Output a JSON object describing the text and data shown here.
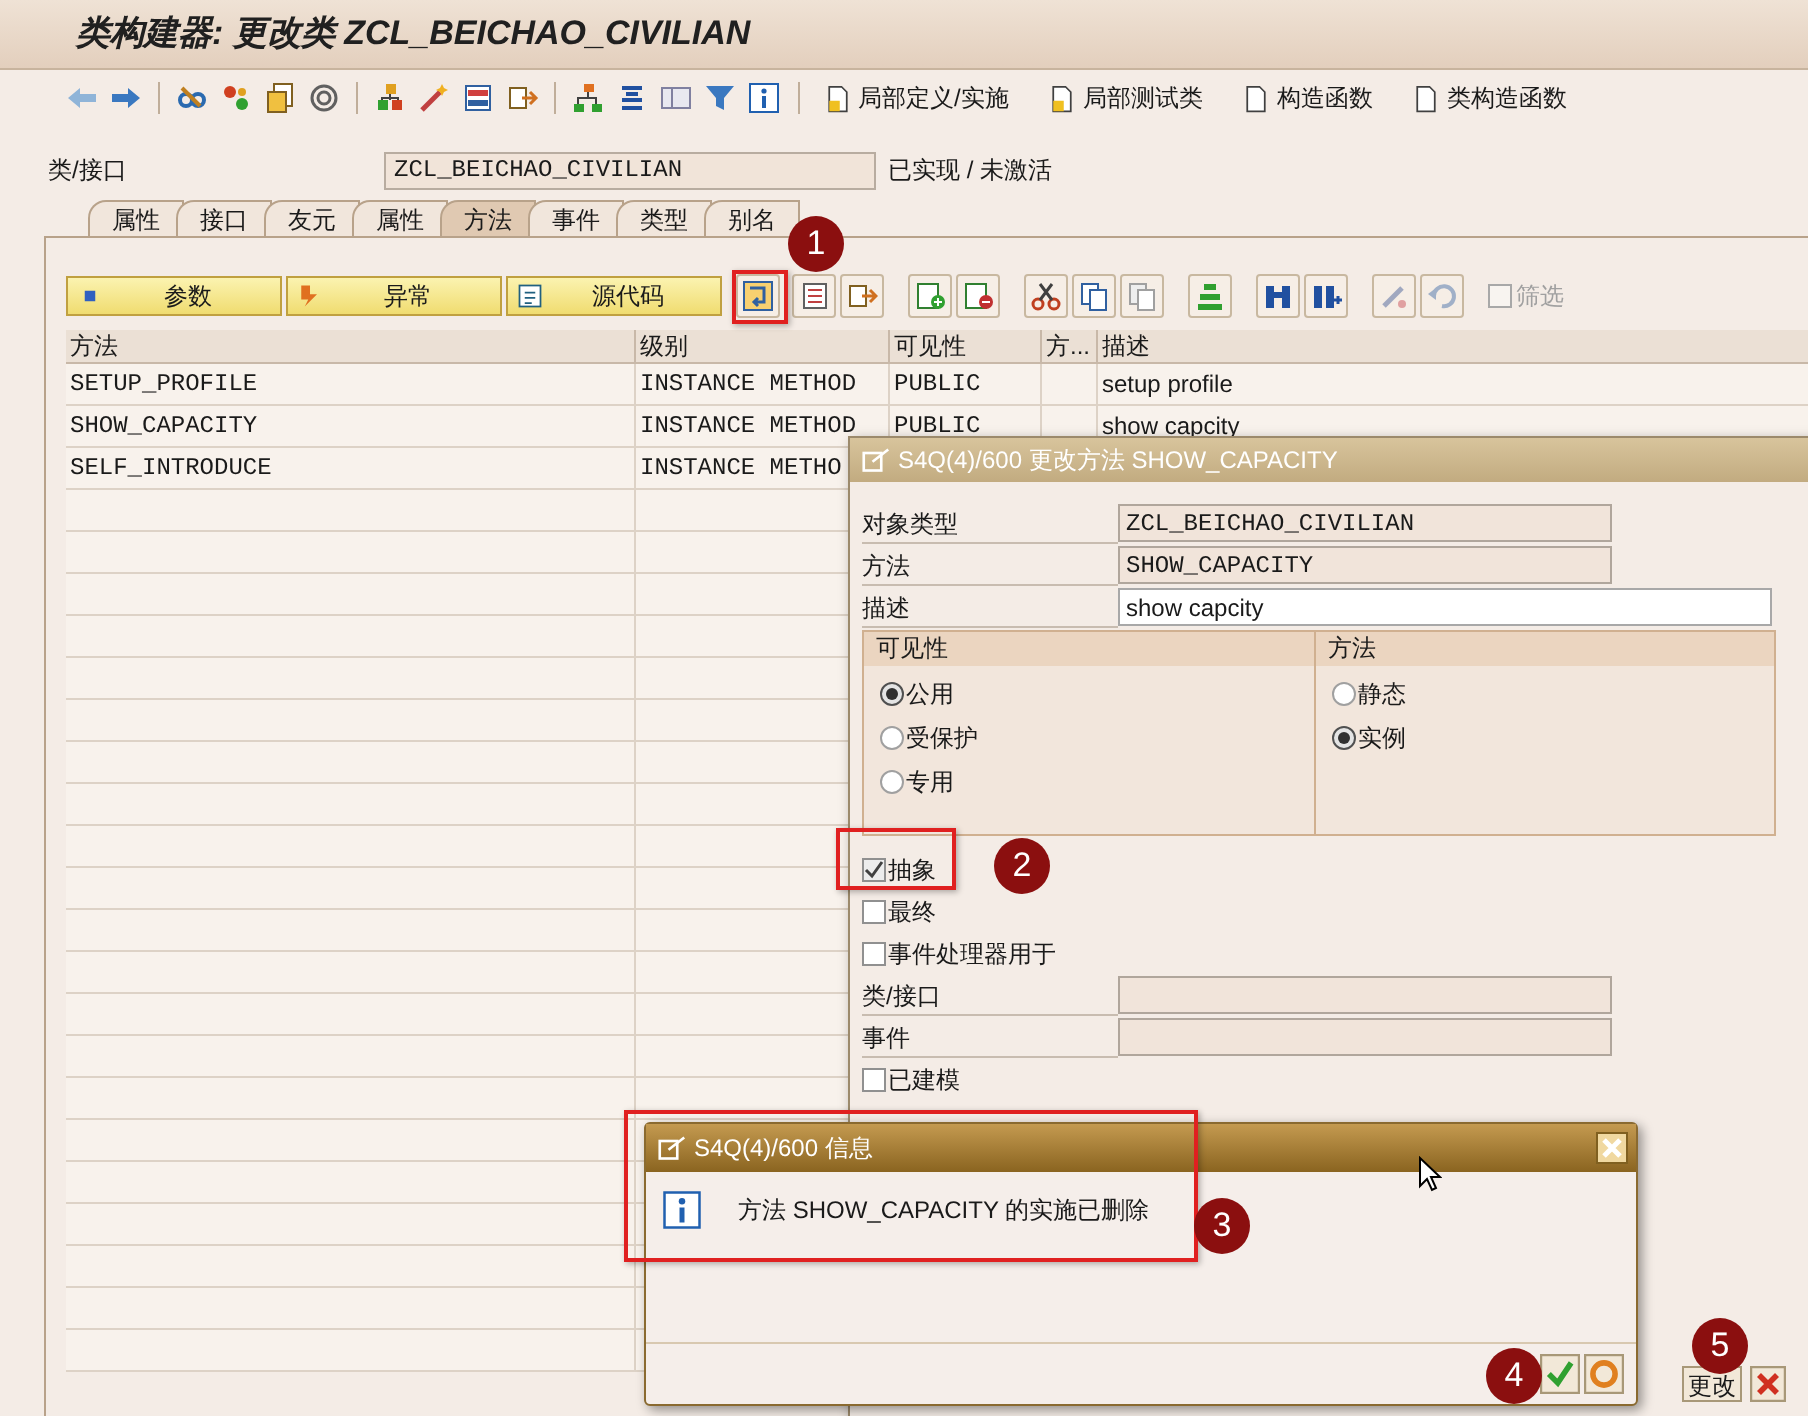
{
  "window": {
    "title": "类构建器: 更改类 ZCL_BEICHAO_CIVILIAN"
  },
  "toolbar": {
    "text_buttons": [
      "局部定义/实施",
      "局部测试类",
      "构造函数",
      "类构造函数"
    ]
  },
  "header": {
    "label": "类/接口",
    "value": "ZCL_BEICHAO_CIVILIAN",
    "status": "已实现 / 未激活"
  },
  "tabs": [
    {
      "label": "属性",
      "selected": false
    },
    {
      "label": "接口",
      "selected": false
    },
    {
      "label": "友元",
      "selected": false
    },
    {
      "label": "属性",
      "selected": false
    },
    {
      "label": "方法",
      "selected": true
    },
    {
      "label": "事件",
      "selected": false
    },
    {
      "label": "类型",
      "selected": false
    },
    {
      "label": "别名",
      "selected": false
    }
  ],
  "method_toolbar": {
    "buttons": [
      "参数",
      "异常",
      "源代码"
    ],
    "filter": {
      "label": "筛选",
      "checked": false,
      "disabled": true
    }
  },
  "table": {
    "columns": [
      "方法",
      "级别",
      "可见性",
      "方...",
      "描述"
    ],
    "rows": [
      [
        "SETUP_PROFILE",
        "INSTANCE METHOD",
        "PUBLIC",
        "",
        "setup profile"
      ],
      [
        "SHOW_CAPACITY",
        "INSTANCE METHOD",
        "PUBLIC",
        "",
        "show capcity"
      ],
      [
        "SELF_INTRODUCE",
        "INSTANCE METHO"
      ]
    ]
  },
  "method_dialog": {
    "title": "S4Q(4)/600 更改方法 SHOW_CAPACITY",
    "fields": [
      {
        "label": "对象类型",
        "value": "ZCL_BEICHAO_CIVILIAN",
        "readonly": true
      },
      {
        "label": "方法",
        "value": "SHOW_CAPACITY",
        "readonly": true
      },
      {
        "label": "描述",
        "value": "show capcity",
        "readonly": false
      }
    ],
    "groups": [
      {
        "title": "可见性",
        "options": [
          {
            "label": "公用",
            "selected": true
          },
          {
            "label": "受保护",
            "selected": false
          },
          {
            "label": "专用",
            "selected": false
          }
        ]
      },
      {
        "title": "方法",
        "options": [
          {
            "label": "静态",
            "selected": false
          },
          {
            "label": "实例",
            "selected": true
          }
        ]
      }
    ],
    "checkboxes": [
      {
        "label": "抽象",
        "checked": true
      },
      {
        "label": "最终",
        "checked": false
      },
      {
        "label": "事件处理器用于",
        "checked": false
      }
    ],
    "event_fields": [
      {
        "label": "类/接口",
        "readonly": true
      },
      {
        "label": "事件",
        "readonly": true
      }
    ],
    "modeled": {
      "label": "已建模",
      "checked": false
    },
    "footer_button": "更改"
  },
  "info_dialog": {
    "title": "S4Q(4)/600 信息",
    "message": "方法 SHOW_CAPACITY 的实施已删除"
  },
  "annotations": [
    {
      "label": "1"
    },
    {
      "label": "2"
    },
    {
      "label": "3"
    },
    {
      "label": "4"
    },
    {
      "label": "5"
    }
  ]
}
